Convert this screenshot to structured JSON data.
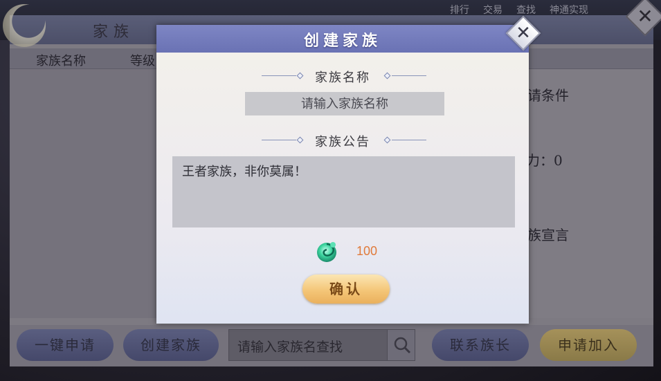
{
  "background": {
    "top_links": [
      "排行",
      "交易",
      "查找",
      "神通实现"
    ],
    "panel_title": "家族",
    "columns": [
      "家族名称",
      "等级"
    ],
    "right_labels": [
      "请条件",
      "力：0",
      "族宣言"
    ],
    "bottom_buttons": {
      "one_click_apply": "一键申请",
      "create_family": "创建家族",
      "contact_leader": "联系族长",
      "apply_join": "申请加入"
    },
    "search_placeholder": "请输入家族名查找"
  },
  "modal": {
    "title": "创建家族",
    "name_section": "家族名称",
    "name_placeholder": "请输入家族名称",
    "notice_section": "家族公告",
    "notice_value": "王者家族，非你莫属！",
    "cost_icon": "jade-token-icon",
    "cost_value": "100",
    "confirm_label": "确认"
  },
  "colors": {
    "modal_header": "#7078b8",
    "cost": "#e07a3a",
    "confirm": "#f4c678"
  }
}
